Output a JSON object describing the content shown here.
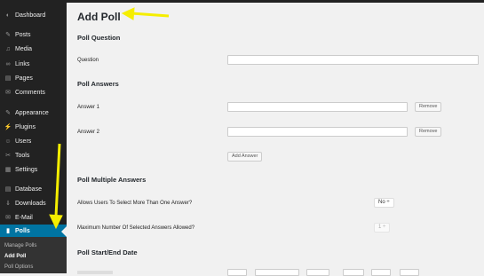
{
  "sidebar": {
    "items": [
      {
        "label": "Dashboard",
        "icon": "dashboard-icon",
        "glyph": "◐"
      },
      {
        "label": "Posts",
        "icon": "pin-icon",
        "glyph": "✎"
      },
      {
        "label": "Media",
        "icon": "media-icon",
        "glyph": "♫"
      },
      {
        "label": "Links",
        "icon": "link-icon",
        "glyph": "∞"
      },
      {
        "label": "Pages",
        "icon": "page-icon",
        "glyph": "▤"
      },
      {
        "label": "Comments",
        "icon": "comment-icon",
        "glyph": "✉"
      },
      {
        "label": "Appearance",
        "icon": "brush-icon",
        "glyph": "✎"
      },
      {
        "label": "Plugins",
        "icon": "plug-icon",
        "glyph": "⚡"
      },
      {
        "label": "Users",
        "icon": "user-icon",
        "glyph": "☺"
      },
      {
        "label": "Tools",
        "icon": "wrench-icon",
        "glyph": "✂"
      },
      {
        "label": "Settings",
        "icon": "settings-icon",
        "glyph": "▦"
      },
      {
        "label": "Database",
        "icon": "database-icon",
        "glyph": "▤"
      },
      {
        "label": "Downloads",
        "icon": "download-icon",
        "glyph": "⇓"
      },
      {
        "label": "E-Mail",
        "icon": "email-icon",
        "glyph": "✉"
      },
      {
        "label": "Polls",
        "icon": "bar-chart-icon",
        "glyph": "▮",
        "active": true
      }
    ],
    "submenu": [
      "Manage Polls",
      "Add Poll",
      "Poll Options"
    ],
    "submenu_current": "Add Poll"
  },
  "main": {
    "title": "Add Poll",
    "question_section": "Poll Question",
    "question_label": "Question",
    "answers_section": "Poll Answers",
    "answer1_label": "Answer 1",
    "answer2_label": "Answer 2",
    "remove_label": "Remove",
    "add_answer_label": "Add Answer",
    "multiple_section": "Poll Multiple Answers",
    "allow_multiple_label": "Allows Users To Select More Than One Answer?",
    "allow_multiple_value": "No ÷",
    "max_answers_label": "Maximum Number Of Selected Answers Allowed?",
    "max_answers_value": "1 ÷",
    "dates_section": "Poll Start/End Date"
  },
  "colors": {
    "sidebar_bg": "#222222",
    "active_bg": "#0074a2",
    "annotation_arrow": "#f5ee00"
  }
}
